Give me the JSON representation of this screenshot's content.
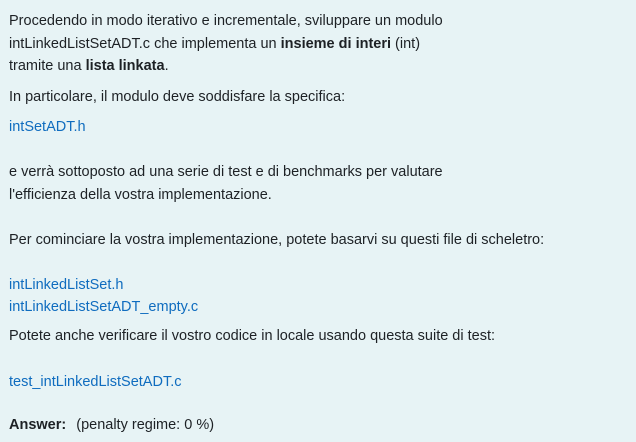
{
  "question": {
    "intro_1": "Procedendo in modo iterativo e incrementale, sviluppare un modulo",
    "intro_2_prefix": "intLinkedListSetADT.c che implementa un ",
    "intro_2_bold": "insieme di interi",
    "intro_2_suffix": " (int)",
    "intro_3_prefix": "tramite una ",
    "intro_3_bold": "lista linkata",
    "intro_3_suffix": ".",
    "spec_text": "In particolare, il modulo deve soddisfare la specifica:",
    "spec_link": "intSetADT.h",
    "test_text_1": "e verrà sottoposto ad una serie di test e di benchmarks per valutare",
    "test_text_2": "l'efficienza della vostra implementazione.",
    "skeleton_text": "Per cominciare la vostra implementazione, potete basarvi su questi file di scheletro:",
    "skeleton_link_1": "intLinkedListSet.h",
    "skeleton_link_2": "intLinkedListSetADT_empty.c",
    "verify_text": "Potete anche verificare il vostro codice in locale usando questa suite di test:",
    "test_link": "test_intLinkedListSetADT.c"
  },
  "answer": {
    "label": "Answer:",
    "penalty": "(penalty regime: 0 %)"
  }
}
